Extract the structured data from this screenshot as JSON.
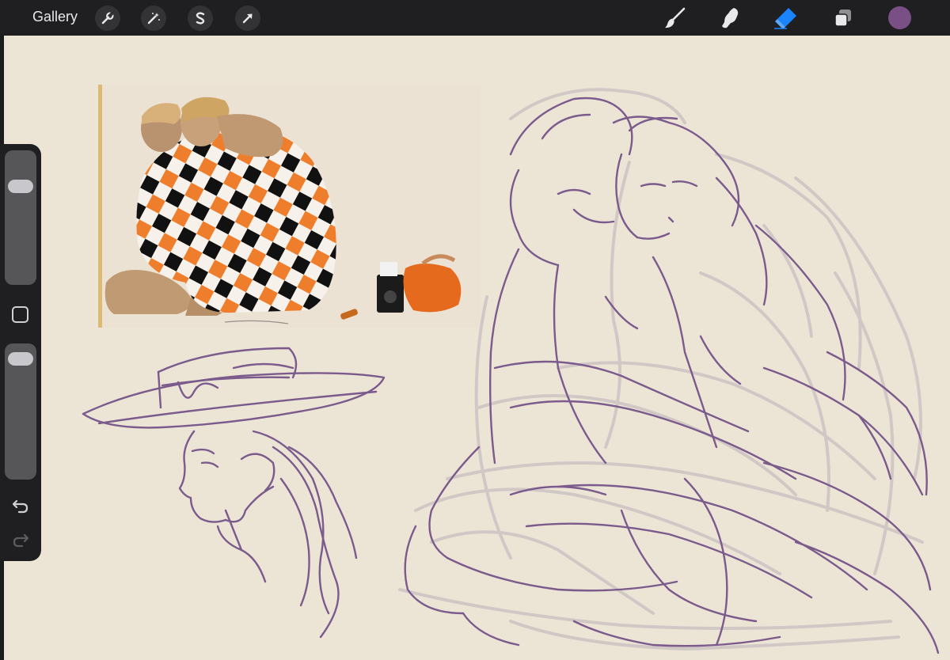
{
  "topbar": {
    "gallery_label": "Gallery",
    "left_tools": [
      "wrench-icon",
      "magic-wand-icon",
      "selection-s-icon",
      "transform-arrow-icon"
    ],
    "right_tools": [
      "brush-icon",
      "smudge-icon",
      "eraser-icon",
      "layers-icon"
    ],
    "active_tool": "eraser-icon",
    "current_color": "#7a4f86"
  },
  "sidebar": {
    "brush_size_level": 0.23,
    "opacity_level": 0.05,
    "buttons": [
      "modify-button",
      "undo-icon",
      "redo-icon"
    ]
  },
  "canvas": {
    "background_color": "#ece5d6",
    "stroke_color": "#7b5a8c",
    "light_stroke_color": "#c9bfc1"
  }
}
